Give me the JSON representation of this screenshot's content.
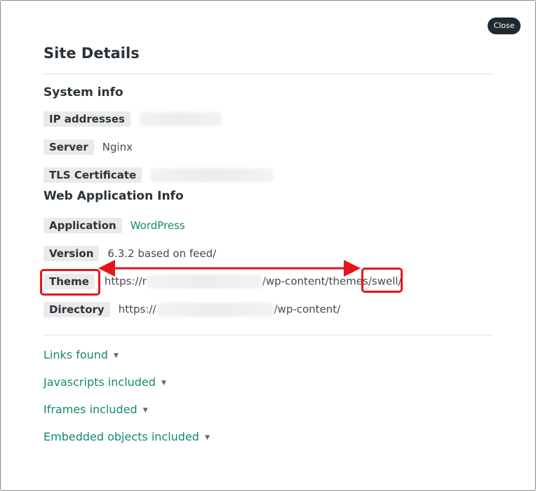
{
  "dialog": {
    "close_label": "Close",
    "title": "Site Details"
  },
  "system_info": {
    "heading": "System info",
    "ip_label": "IP addresses",
    "server_label": "Server",
    "server_value": "Nginx",
    "tls_label": "TLS Certificate"
  },
  "web_app_info": {
    "heading": "Web Application Info",
    "application_label": "Application",
    "application_value": "WordPress",
    "version_label": "Version",
    "version_value": "6.3.2 based on feed/",
    "theme_label": "Theme",
    "theme_value_prefix": "https://r",
    "theme_value_mid": "/wp-content/themes",
    "theme_value_suffix": "/swell/",
    "directory_label": "Directory",
    "directory_value_prefix": "https://",
    "directory_value_suffix": "/wp-content/"
  },
  "expanders": {
    "links": "Links found",
    "javascripts": "Javascripts included",
    "iframes": "Iframes included",
    "embedded": "Embedded objects included"
  },
  "annotation_color": "#e8141c",
  "accent_color": "#138a72"
}
